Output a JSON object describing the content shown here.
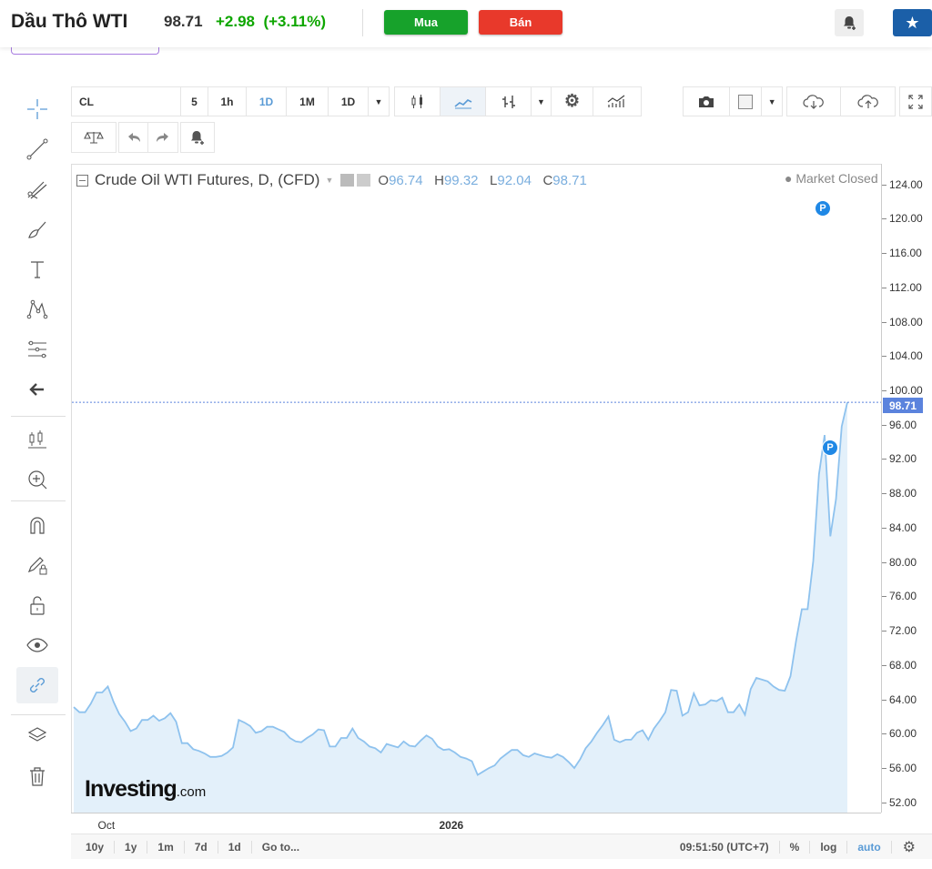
{
  "header": {
    "title": "Dầu Thô WTI",
    "price": "98.71",
    "change": "+2.98",
    "change_pct": "(+3.11%)",
    "buy_label": "Mua",
    "sell_label": "Bán",
    "change_color": "#0ea600",
    "buy_color": "#17a22b",
    "sell_color": "#e8392b"
  },
  "toolbar": {
    "symbol": "CL",
    "intervals": [
      "5",
      "1h",
      "1D",
      "1M",
      "1D"
    ],
    "active_interval": "1D"
  },
  "legend": {
    "name": "Crude Oil WTI Futures, D, (CFD)",
    "o_label": "O",
    "o": "96.74",
    "h_label": "H",
    "h": "99.32",
    "l_label": "L",
    "l": "92.04",
    "c_label": "C",
    "c": "98.71",
    "status": "● Market Closed"
  },
  "last_price_tag": "98.71",
  "logo": {
    "main": "Investing",
    "suffix": ".com"
  },
  "bottom": {
    "ranges": [
      "10y",
      "1y",
      "1m",
      "7d",
      "1d",
      "Go to..."
    ],
    "time": "09:51:50 (UTC+7)",
    "pct": "%",
    "log": "log",
    "auto": "auto"
  },
  "chart_data": {
    "type": "area",
    "yticks": [
      "124.00",
      "120.00",
      "116.00",
      "112.00",
      "108.00",
      "104.00",
      "100.00",
      "96.00",
      "92.00",
      "88.00",
      "84.00",
      "80.00",
      "76.00",
      "72.00",
      "68.00",
      "64.00",
      "60.00",
      "56.00",
      "52.00"
    ],
    "ylim": [
      50.8,
      126.4
    ],
    "xlabels": [
      {
        "label": "Oct",
        "index": 6
      },
      {
        "label": "2026",
        "index": 66
      }
    ],
    "line_color": "#8ec2ee",
    "fill_color": "#e3f0fa",
    "last_value": 98.71,
    "values": [
      63.2,
      62.6,
      62.6,
      63.6,
      64.9,
      64.9,
      65.6,
      63.8,
      62.4,
      61.5,
      60.4,
      60.7,
      61.7,
      61.7,
      62.2,
      61.6,
      61.9,
      62.5,
      61.5,
      59,
      59,
      58.3,
      58.1,
      57.8,
      57.4,
      57.4,
      57.5,
      57.9,
      58.5,
      61.7,
      61.4,
      61,
      60.2,
      60.4,
      60.9,
      60.9,
      60.6,
      60.3,
      59.6,
      59.2,
      59.1,
      59.6,
      60,
      60.6,
      60.5,
      58.6,
      58.6,
      59.6,
      59.6,
      60.7,
      59.6,
      59.2,
      58.6,
      58.4,
      57.9,
      58.9,
      58.7,
      58.5,
      59.2,
      58.7,
      58.6,
      59.3,
      59.9,
      59.5,
      58.6,
      58.2,
      58.3,
      57.9,
      57.4,
      57.2,
      56.9,
      55.3,
      55.7,
      56.1,
      56.4,
      57.2,
      57.7,
      58.2,
      58.2,
      57.6,
      57.4,
      57.8,
      57.6,
      57.4,
      57.3,
      57.7,
      57.4,
      56.8,
      56.1,
      57.1,
      58.4,
      59.2,
      60.2,
      61.1,
      62.1,
      59.4,
      59.1,
      59.4,
      59.4,
      60.2,
      60.5,
      59.4,
      60.7,
      61.6,
      62.6,
      65.2,
      65.1,
      62.2,
      62.6,
      64.8,
      63.4,
      63.5,
      64,
      63.9,
      64.3,
      62.6,
      62.6,
      63.5,
      62.3,
      65.3,
      66.6,
      66.4,
      66.2,
      65.6,
      65.2,
      65.1,
      66.8,
      71,
      74.6,
      74.6,
      80.2,
      90.3,
      94.9,
      83.1,
      87.4,
      95.9,
      98.71
    ]
  }
}
